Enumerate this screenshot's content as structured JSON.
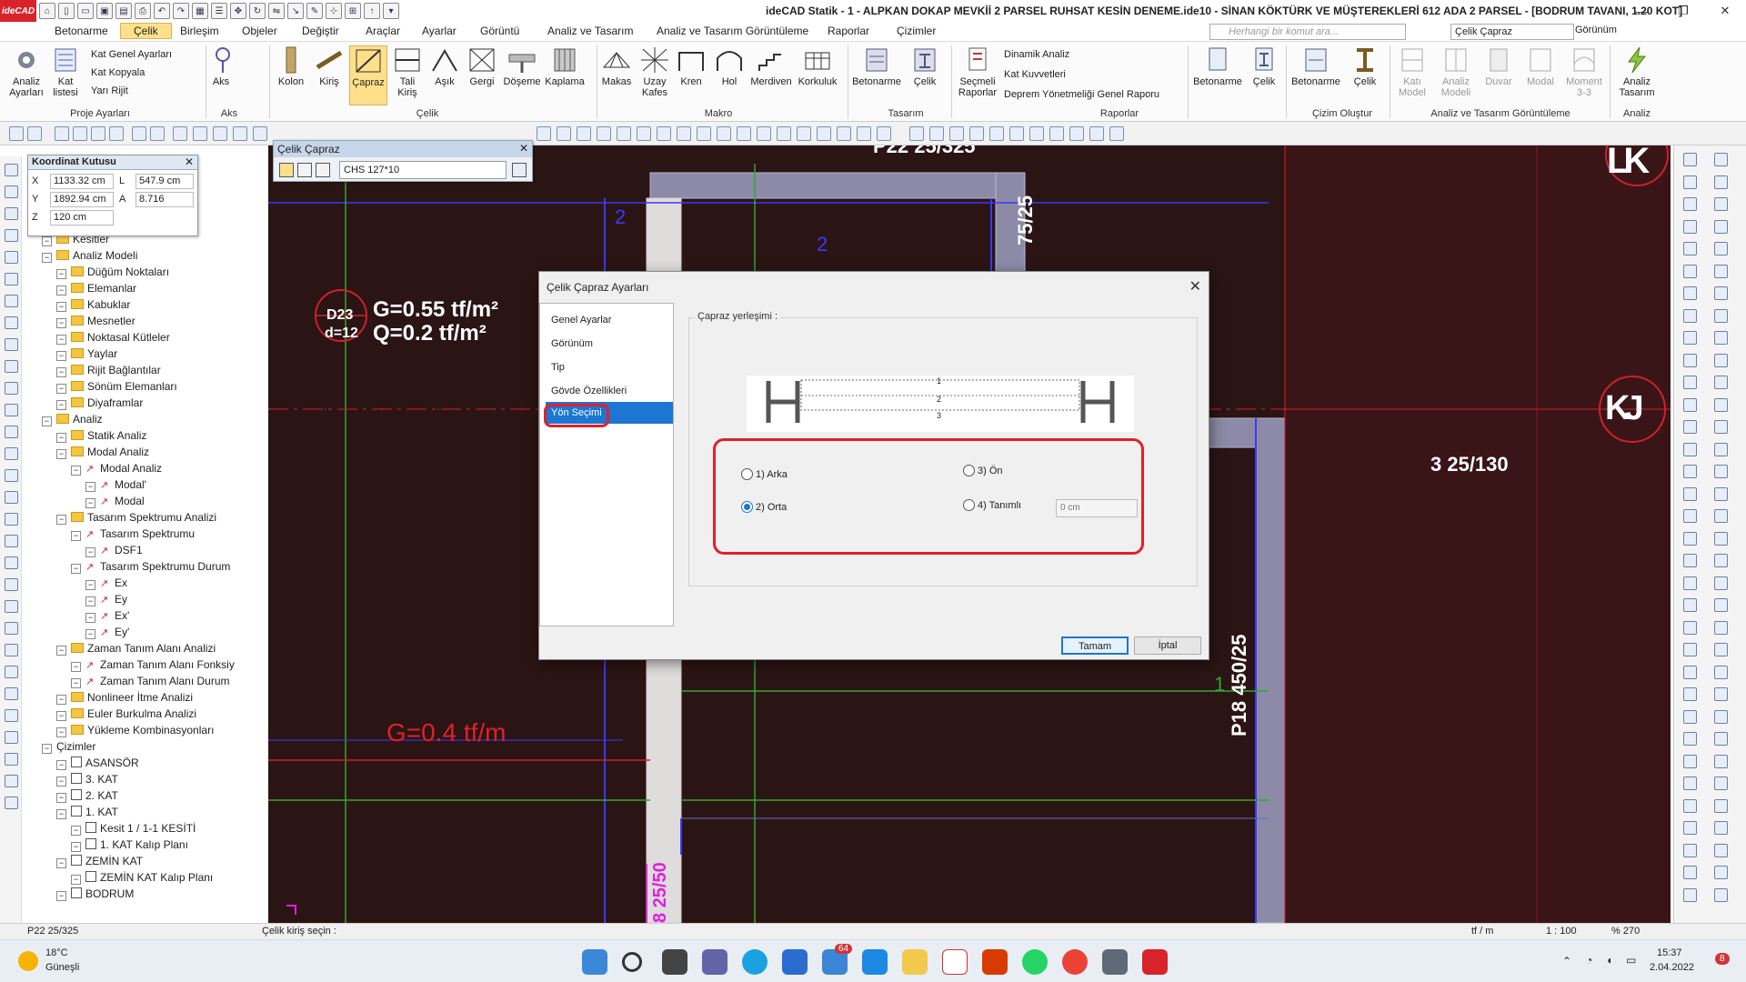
{
  "window": {
    "title": "ideCAD Statik - 1 - ALPKAN DOKAP MEVKİİ 2 PARSEL RUHSAT KESİN DENEME.ide10 - SİNAN KÖKTÜRK VE MÜŞTEREKLERİ      612 ADA 2 PARSEL - [BODRUM TAVANI,  1.20 KOT]",
    "logo": "ideCAD",
    "minimize": "—",
    "restore": "❐",
    "close": "✕"
  },
  "menu": {
    "items": [
      "Betonarme",
      "Çelik",
      "Birleşim",
      "Objeler",
      "Değiştir",
      "Araçlar",
      "Ayarlar",
      "Görüntü",
      "Analiz ve Tasarım",
      "Analiz ve Tasarım Görüntüleme",
      "Raporlar",
      "Çizimler"
    ],
    "active": "Çelik",
    "search_placeholder": "Herhangi bir komut ara...",
    "steel_combo": "Çelik Çapraz",
    "view_combo": "Görünüm"
  },
  "ribbon": {
    "buttons": [
      {
        "label": "Analiz\nAyarları"
      },
      {
        "label": "Kat\nlistesi"
      },
      {
        "label": "Aks"
      },
      {
        "label": "Kolon"
      },
      {
        "label": "Kiriş"
      },
      {
        "label": "Çapraz"
      },
      {
        "label": "Tali\nKiriş"
      },
      {
        "label": "Aşık"
      },
      {
        "label": "Gergi"
      },
      {
        "label": "Döşeme"
      },
      {
        "label": "Kaplama"
      },
      {
        "label": "Makas"
      },
      {
        "label": "Uzay\nKafes"
      },
      {
        "label": "Kren"
      },
      {
        "label": "Hol"
      },
      {
        "label": "Merdiven"
      },
      {
        "label": "Korkuluk"
      },
      {
        "label": "Betonarme"
      },
      {
        "label": "Çelik"
      },
      {
        "label": "Seçmeli\nRaporlar"
      },
      {
        "label": "Betonarme"
      },
      {
        "label": "Çelik"
      },
      {
        "label": "Betonarme"
      },
      {
        "label": "Çelik"
      },
      {
        "label": "Katı\nModel"
      },
      {
        "label": "Analiz\nModeli"
      },
      {
        "label": "Duvar"
      },
      {
        "label": "Modal"
      },
      {
        "label": "Moment\n3-3"
      },
      {
        "label": "Analiz\nTasarım"
      }
    ],
    "small": {
      "kat_genel": "Kat Genel Ayarları",
      "kat_kopyala": "Kat Kopyala",
      "yari_rijit": "Yarı Rijit",
      "dinamik": "Dinamik Analiz",
      "kat_kuvvetleri": "Kat Kuvvetleri",
      "deprem": "Deprem Yönetmeliği Genel Raporu"
    },
    "groups": [
      "Proje Ayarları",
      "Aks",
      "Çelik",
      "Makro",
      "Tasarım",
      "Raporlar",
      "Çizim Oluştur",
      "Analiz ve Tasarım Görüntüleme",
      "Analiz"
    ]
  },
  "coord_box": {
    "title": "Koordinat Kutusu",
    "x_label": "X",
    "x": "1133.32 cm",
    "l_label": "L",
    "l": "547.9 cm",
    "y_label": "Y",
    "y": "1892.94 cm",
    "a_label": "A",
    "a": "8.716",
    "z_label": "Z",
    "z": "120 cm"
  },
  "celik_bar": {
    "title": "Çelik Çapraz",
    "section": "CHS 127*10"
  },
  "tree": [
    {
      "label": "Kesitler",
      "icon": "folder",
      "depth": 1
    },
    {
      "label": "Analiz Modeli",
      "icon": "folder",
      "depth": 1
    },
    {
      "label": "Düğüm Noktaları",
      "icon": "folder",
      "depth": 2
    },
    {
      "label": "Elemanlar",
      "icon": "folder",
      "depth": 2
    },
    {
      "label": "Kabuklar",
      "icon": "folder",
      "depth": 2
    },
    {
      "label": "Mesnetler",
      "icon": "folder",
      "depth": 2
    },
    {
      "label": "Noktasal Kütleler",
      "icon": "folder",
      "depth": 2
    },
    {
      "label": "Yaylar",
      "icon": "folder",
      "depth": 2
    },
    {
      "label": "Rijit Bağlantılar",
      "icon": "folder",
      "depth": 2
    },
    {
      "label": "Sönüm Elemanları",
      "icon": "folder",
      "depth": 2
    },
    {
      "label": "Diyaframlar",
      "icon": "folder",
      "depth": 2
    },
    {
      "label": "Analiz",
      "icon": "folder",
      "depth": 1
    },
    {
      "label": "Statik Analiz",
      "icon": "folder",
      "depth": 2
    },
    {
      "label": "Modal Analiz",
      "icon": "folder",
      "depth": 2
    },
    {
      "label": "Modal Analiz",
      "icon": "red",
      "depth": 3
    },
    {
      "label": "Modal'",
      "icon": "red",
      "depth": 4
    },
    {
      "label": "Modal",
      "icon": "red",
      "depth": 4
    },
    {
      "label": "Tasarım Spektrumu Analizi",
      "icon": "folder",
      "depth": 2
    },
    {
      "label": "Tasarım Spektrumu",
      "icon": "red",
      "depth": 3
    },
    {
      "label": "DSF1",
      "icon": "red",
      "depth": 4
    },
    {
      "label": "Tasarım Spektrumu Durum",
      "icon": "red",
      "depth": 3
    },
    {
      "label": "Ex",
      "icon": "red",
      "depth": 4
    },
    {
      "label": "Ey",
      "icon": "red",
      "depth": 4
    },
    {
      "label": "Ex'",
      "icon": "red",
      "depth": 4
    },
    {
      "label": "Ey'",
      "icon": "red",
      "depth": 4
    },
    {
      "label": "Zaman Tanım Alanı Analizi",
      "icon": "folder",
      "depth": 2
    },
    {
      "label": "Zaman Tanım Alanı Fonksiy",
      "icon": "red",
      "depth": 3
    },
    {
      "label": "Zaman Tanım Alanı Durum",
      "icon": "red",
      "depth": 3
    },
    {
      "label": "Nonlineer İtme Analizi",
      "icon": "folder",
      "depth": 2
    },
    {
      "label": "Euler Burkulma Analizi",
      "icon": "folder",
      "depth": 2
    },
    {
      "label": "Yükleme Kombinasyonları",
      "icon": "folder",
      "depth": 2
    },
    {
      "label": "Çizimler",
      "icon": "none",
      "depth": 1
    },
    {
      "label": "ASANSÖR",
      "icon": "doc",
      "depth": 2
    },
    {
      "label": "3. KAT",
      "icon": "doc",
      "depth": 2
    },
    {
      "label": "2. KAT",
      "icon": "doc",
      "depth": 2
    },
    {
      "label": "1. KAT",
      "icon": "doc",
      "depth": 2
    },
    {
      "label": "Kesit 1 / 1-1 KESİTİ",
      "icon": "doc",
      "depth": 3
    },
    {
      "label": "1. KAT Kalıp Planı",
      "icon": "doc",
      "depth": 3
    },
    {
      "label": "ZEMİN KAT",
      "icon": "doc",
      "depth": 2
    },
    {
      "label": "ZEMİN KAT Kalıp Planı",
      "icon": "doc",
      "depth": 3
    },
    {
      "label": "BODRUM",
      "icon": "doc",
      "depth": 2
    }
  ],
  "drawing": {
    "slab_id": "D23",
    "slab_d": "d=12",
    "load_g": "G=0.55 tf/m²",
    "load_q": "Q=0.2 tf/m²",
    "line_load": "G=0.4 tf/m",
    "axis_lk": "LK",
    "axis_kj": "KJ",
    "beam_top": "P22 25/325",
    "beam_right_top": "75/25",
    "beam_3": "3 25/130",
    "beam_p18": "P18 450/25",
    "beam_bottom": "8 25/50",
    "axis_2a": "2",
    "axis_2b": "2",
    "axis_1": "1"
  },
  "dialog": {
    "title": "Çelik Çapraz Ayarları",
    "close": "✕",
    "nav": [
      "Genel Ayarlar",
      "Görünüm",
      "Tip",
      "Gövde Özellikleri",
      "Yön Seçimi"
    ],
    "selected_nav": "Yön Seçimi",
    "panel_label": "Çapraz yerleşimi :",
    "diagram_labels": [
      "1",
      "2",
      "3"
    ],
    "options": {
      "arka": "1) Arka",
      "orta": "2) Orta",
      "on": "3) Ön",
      "tanimli": "4) Tanımlı"
    },
    "selected_option": "orta",
    "offset_placeholder": "0 cm",
    "ok": "Tamam",
    "cancel": "İptal",
    "highlight_color": "#e0202a"
  },
  "status": {
    "left": "P22 25/325",
    "prompt": "Çelik kiriş seçin :",
    "unit": "tf / m",
    "scale": "1 : 100",
    "zoom": "% 270"
  },
  "taskbar": {
    "temperature": "18°C",
    "weather": "Güneşli",
    "time": "15:37",
    "date": "2.04.2022",
    "mail_badge": "64",
    "notif_badge": "8"
  }
}
